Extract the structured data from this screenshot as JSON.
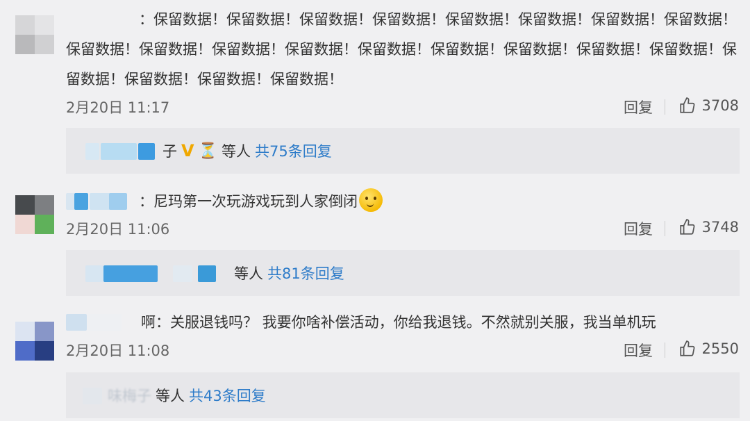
{
  "comments": [
    {
      "username_fragment": "：",
      "text": "保留数据！保留数据！保留数据！保留数据！保留数据！保留数据！保留数据！保留数据！保留数据！保留数据！保留数据！保留数据！保留数据！保留数据！保留数据！保留数据！保留数据！保留数据！保留数据！保留数据！保留数据！",
      "time": "2月20日 11:17",
      "reply_label": "回复",
      "likes": "3708",
      "replies": {
        "name_fragment": "子",
        "badge": "V",
        "suffix": "等人",
        "total": "共75条回复"
      }
    },
    {
      "username_fragment": "：",
      "text": "尼玛第一次玩游戏玩到人家倒闭",
      "time": "2月20日 11:06",
      "reply_label": "回复",
      "likes": "3748",
      "replies": {
        "suffix": "等人",
        "total": "共81条回复"
      }
    },
    {
      "username_fragment": "啊：",
      "text": "关服退钱吗？ 我要你啥补偿活动，你给我退钱。不然就别关服，我当单机玩",
      "time": "2月20日 11:08",
      "reply_label": "回复",
      "likes": "2550",
      "replies": {
        "name_fragment": "味梅子",
        "suffix": "等人",
        "total": "共43条回复"
      }
    }
  ],
  "colors": {
    "link": "#2e7cc9",
    "background": "#f0f0f2",
    "reply_box": "#e7e7ea"
  },
  "icons": {
    "like": "thumbs-up-icon"
  }
}
